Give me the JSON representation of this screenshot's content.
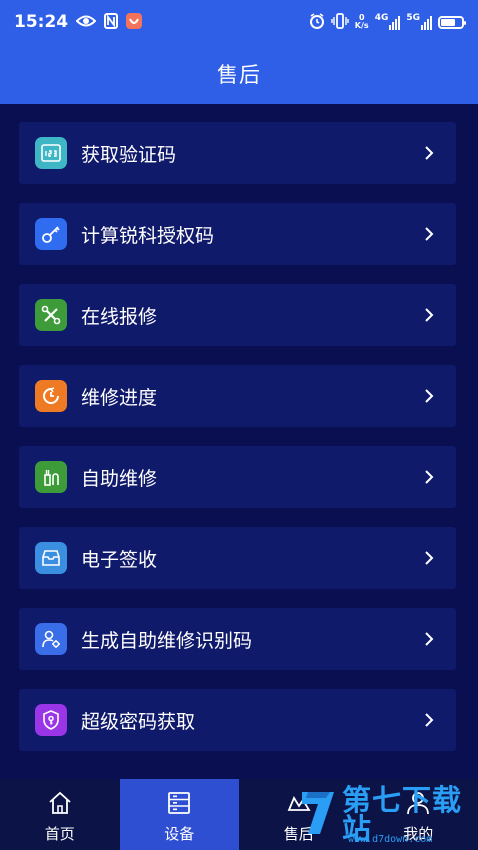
{
  "status_bar": {
    "time": "15:24",
    "net_speed_value": "0",
    "net_speed_unit": "K/s",
    "signal1_label": "4G",
    "signal2_label": "5G"
  },
  "header": {
    "title": "售后"
  },
  "menu": {
    "items": [
      {
        "label": "获取验证码",
        "icon": "verification-code-icon",
        "color": "#3fb6c6"
      },
      {
        "label": "计算锐科授权码",
        "icon": "key-icon",
        "color": "#2f6cf0"
      },
      {
        "label": "在线报修",
        "icon": "tools-icon",
        "color": "#3e9b3a"
      },
      {
        "label": "维修进度",
        "icon": "progress-icon",
        "color": "#ee7a24"
      },
      {
        "label": "自助维修",
        "icon": "self-repair-icon",
        "color": "#3e9b3a"
      },
      {
        "label": "电子签收",
        "icon": "e-sign-icon",
        "color": "#3b8fe0"
      },
      {
        "label": "生成自助维修识别码",
        "icon": "user-id-icon",
        "color": "#3a6de8"
      },
      {
        "label": "超级密码获取",
        "icon": "shield-key-icon",
        "color": "#9a35e8"
      }
    ]
  },
  "tabbar": {
    "tabs": [
      {
        "label": "首页",
        "icon": "home-icon"
      },
      {
        "label": "设备",
        "icon": "device-icon"
      },
      {
        "label": "售后",
        "icon": "service-icon"
      },
      {
        "label": "我的",
        "icon": "user-icon"
      }
    ],
    "active": "设备"
  },
  "watermark": {
    "text": "第七下载站",
    "url": "www.d7down.com"
  },
  "colors": {
    "primary": "#2f5fe6",
    "background": "#0a0f52",
    "card": "#101a6b",
    "tab_active": "#2f4fd3"
  }
}
